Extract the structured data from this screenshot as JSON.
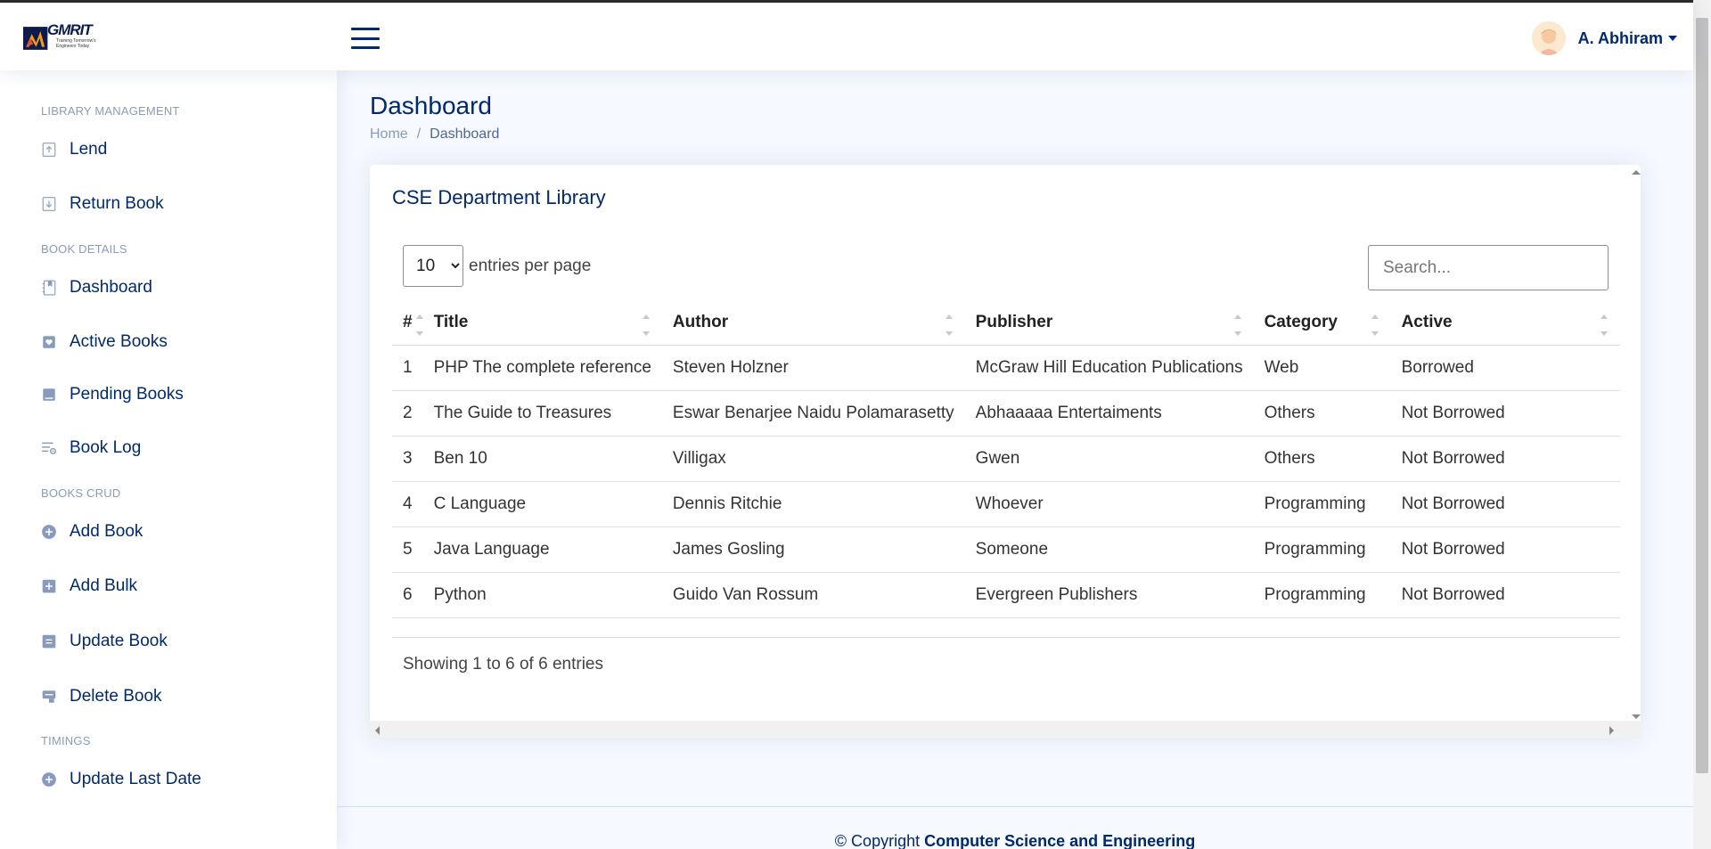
{
  "brand": {
    "name": "GMRIT",
    "tagline": "Training Tomorrow's Engineers Today"
  },
  "header": {
    "user_name": "A. Abhiram"
  },
  "sidebar": {
    "sections": [
      {
        "heading": "LIBRARY MANAGEMENT",
        "items": [
          {
            "label": "Lend",
            "icon": "upload-box-icon"
          },
          {
            "label": "Return Book",
            "icon": "download-box-icon"
          }
        ]
      },
      {
        "heading": "BOOK DETAILS",
        "items": [
          {
            "label": "Dashboard",
            "icon": "journal-bookmark-icon"
          },
          {
            "label": "Active Books",
            "icon": "bookmark-heart-icon"
          },
          {
            "label": "Pending Books",
            "icon": "book-icon"
          },
          {
            "label": "Book Log",
            "icon": "list-gear-icon"
          }
        ]
      },
      {
        "heading": "BOOKS CRUD",
        "items": [
          {
            "label": "Add Book",
            "icon": "plus-circle-icon"
          },
          {
            "label": "Add Bulk",
            "icon": "plus-square-icon"
          },
          {
            "label": "Update Book",
            "icon": "update-box-icon"
          },
          {
            "label": "Delete Book",
            "icon": "trash-box-icon"
          }
        ]
      },
      {
        "heading": "TIMINGS",
        "items": [
          {
            "label": "Update Last Date",
            "icon": "plus-circle-icon"
          }
        ]
      }
    ]
  },
  "page": {
    "title": "Dashboard",
    "breadcrumb": {
      "home": "Home",
      "separator": "/",
      "current": "Dashboard"
    }
  },
  "card": {
    "title": "CSE Department Library",
    "per_page_value": "10",
    "per_page_label": "entries per page",
    "search_placeholder": "Search...",
    "columns": [
      "#",
      "Title",
      "Author",
      "Publisher",
      "Category",
      "Active"
    ],
    "rows": [
      [
        "1",
        "PHP The complete reference",
        "Steven Holzner",
        "McGraw Hill Education Publications",
        "Web",
        "Borrowed"
      ],
      [
        "2",
        "The Guide to Treasures",
        "Eswar Benarjee Naidu Polamarasetty",
        "Abhaaaaa Entertaiments",
        "Others",
        "Not Borrowed"
      ],
      [
        "3",
        "Ben 10",
        "Villigax",
        "Gwen",
        "Others",
        "Not Borrowed"
      ],
      [
        "4",
        "C Language",
        "Dennis Ritchie",
        "Whoever",
        "Programming",
        "Not Borrowed"
      ],
      [
        "5",
        "Java Language",
        "James Gosling",
        "Someone",
        "Programming",
        "Not Borrowed"
      ],
      [
        "6",
        "Python",
        "Guido Van Rossum",
        "Evergreen Publishers",
        "Programming",
        "Not Borrowed"
      ]
    ],
    "info": "Showing 1 to 6 of 6 entries"
  },
  "footer": {
    "prefix": "© Copyright",
    "org": "Computer Science and Engineering"
  },
  "colors": {
    "primary": "#012970",
    "muted": "#899bbd",
    "background": "#f6f9ff"
  }
}
